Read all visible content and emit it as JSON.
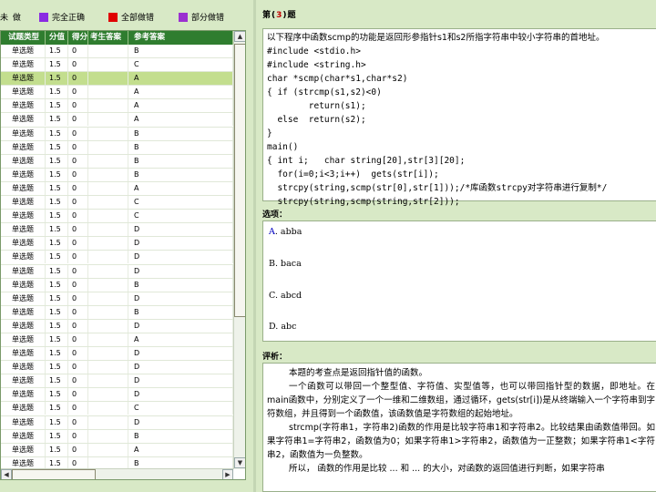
{
  "legend": {
    "label": "未 做",
    "items": [
      {
        "text": "完全正确",
        "color": "#8a2be2"
      },
      {
        "text": "全部做错",
        "color": "#e00000"
      },
      {
        "text": "部分做错",
        "color": "#9b30d0"
      }
    ]
  },
  "grid": {
    "columns": [
      "试题类型",
      "分值",
      "得分",
      "考生答案",
      "参考答案"
    ],
    "rows": [
      {
        "type": "单选题",
        "score": "1.5",
        "got": "0",
        "student": "",
        "answer": "B"
      },
      {
        "type": "单选题",
        "score": "1.5",
        "got": "0",
        "student": "",
        "answer": "C"
      },
      {
        "type": "单选题",
        "score": "1.5",
        "got": "0",
        "student": "",
        "answer": "A",
        "selected": true
      },
      {
        "type": "单选题",
        "score": "1.5",
        "got": "0",
        "student": "",
        "answer": "A"
      },
      {
        "type": "单选题",
        "score": "1.5",
        "got": "0",
        "student": "",
        "answer": "A"
      },
      {
        "type": "单选题",
        "score": "1.5",
        "got": "0",
        "student": "",
        "answer": "A"
      },
      {
        "type": "单选题",
        "score": "1.5",
        "got": "0",
        "student": "",
        "answer": "B"
      },
      {
        "type": "单选题",
        "score": "1.5",
        "got": "0",
        "student": "",
        "answer": "B"
      },
      {
        "type": "单选题",
        "score": "1.5",
        "got": "0",
        "student": "",
        "answer": "B"
      },
      {
        "type": "单选题",
        "score": "1.5",
        "got": "0",
        "student": "",
        "answer": "B"
      },
      {
        "type": "单选题",
        "score": "1.5",
        "got": "0",
        "student": "",
        "answer": "A"
      },
      {
        "type": "单选题",
        "score": "1.5",
        "got": "0",
        "student": "",
        "answer": "C"
      },
      {
        "type": "单选题",
        "score": "1.5",
        "got": "0",
        "student": "",
        "answer": "C"
      },
      {
        "type": "单选题",
        "score": "1.5",
        "got": "0",
        "student": "",
        "answer": "D"
      },
      {
        "type": "单选题",
        "score": "1.5",
        "got": "0",
        "student": "",
        "answer": "D"
      },
      {
        "type": "单选题",
        "score": "1.5",
        "got": "0",
        "student": "",
        "answer": "D"
      },
      {
        "type": "单选题",
        "score": "1.5",
        "got": "0",
        "student": "",
        "answer": "D"
      },
      {
        "type": "单选题",
        "score": "1.5",
        "got": "0",
        "student": "",
        "answer": "B"
      },
      {
        "type": "单选题",
        "score": "1.5",
        "got": "0",
        "student": "",
        "answer": "D"
      },
      {
        "type": "单选题",
        "score": "1.5",
        "got": "0",
        "student": "",
        "answer": "B"
      },
      {
        "type": "单选题",
        "score": "1.5",
        "got": "0",
        "student": "",
        "answer": "D"
      },
      {
        "type": "单选题",
        "score": "1.5",
        "got": "0",
        "student": "",
        "answer": "A"
      },
      {
        "type": "单选题",
        "score": "1.5",
        "got": "0",
        "student": "",
        "answer": "D"
      },
      {
        "type": "单选题",
        "score": "1.5",
        "got": "0",
        "student": "",
        "answer": "D"
      },
      {
        "type": "单选题",
        "score": "1.5",
        "got": "0",
        "student": "",
        "answer": "D"
      },
      {
        "type": "单选题",
        "score": "1.5",
        "got": "0",
        "student": "",
        "answer": "D"
      },
      {
        "type": "单选题",
        "score": "1.5",
        "got": "0",
        "student": "",
        "answer": "C"
      },
      {
        "type": "单选题",
        "score": "1.5",
        "got": "0",
        "student": "",
        "answer": "D"
      },
      {
        "type": "单选题",
        "score": "1.5",
        "got": "0",
        "student": "",
        "answer": "B"
      },
      {
        "type": "单选题",
        "score": "1.5",
        "got": "0",
        "student": "",
        "answer": "A"
      },
      {
        "type": "单选题",
        "score": "1.5",
        "got": "0",
        "student": "",
        "answer": "B"
      }
    ]
  },
  "question": {
    "title_prefix": "第(",
    "number": "3",
    "title_suffix": ")题",
    "lines": [
      "以下程序中函数scmp的功能是返回形参指针s1和s2所指字符串中较小字符串的首地址。",
      "#include <stdio.h>",
      "#include <string.h>",
      "char *scmp(char*s1,char*s2)",
      "{ if (strcmp(s1,s2)<0)",
      "        return(s1);",
      "  else  return(s2);",
      "}",
      "main()",
      "{ int i;   char string[20],str[3][20];",
      "  for(i=0;i<3;i++)  gets(str[i]);",
      "  strcpy(string,scmp(str[0],str[1]));/*库函数strcpy对字符串进行复制*/",
      "  strcpy(string,scmp(string,str[2]));"
    ]
  },
  "options": {
    "label": "选项：",
    "items": [
      {
        "key": "A",
        "text": ". abba"
      },
      {
        "key": "B",
        "text": ". baca"
      },
      {
        "key": "C",
        "text": ". abcd"
      },
      {
        "key": "D",
        "text": ". abc"
      }
    ]
  },
  "analysis": {
    "label": "评析：",
    "paragraphs": [
      "本题的考查点是返回指针值的函数。",
      "一个函数可以带回一个整型值、字符值、实型值等，也可以带回指针型的数据，即地址。在main函数中，分别定义了一个一维和二维数组，通过循环，gets(str[i])是从终端输入一个字符串到字符数组，并且得到一个函数值，该函数值是字符数组的起始地址。",
      "strcmp(字符串1，字符串2)函数的作用是比较字符串1和字符串2。比较结果由函数值带回。如果字符串1=字符串2，函数值为0；如果字符串1>字符串2，函数值为一正整数；如果字符串1<字符串2，函数值为一负整数。",
      "所以，      函数的作用是比较 ... 和 ... 的大小，对函数的返回值进行判断，如果字符串"
    ]
  }
}
